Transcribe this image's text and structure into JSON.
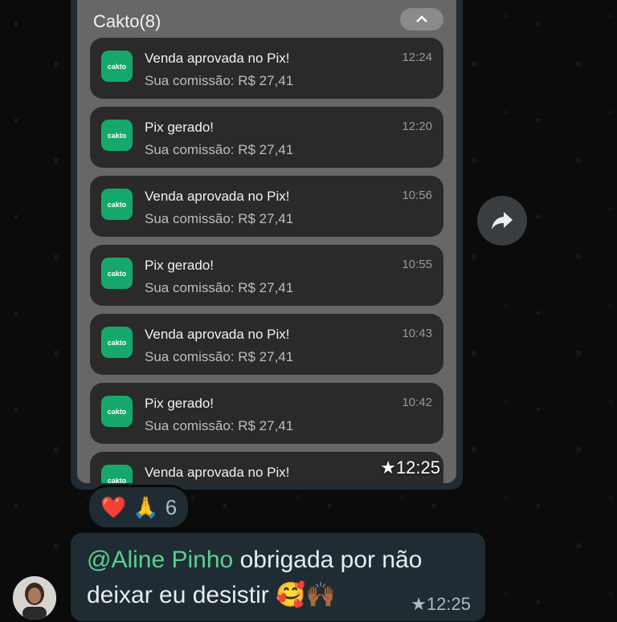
{
  "image_message": {
    "group_title": "Cakto(8)",
    "notifications": [
      {
        "title": "Venda aprovada no Pix!",
        "body": "Sua comissão: R$ 27,41",
        "time": "12:24"
      },
      {
        "title": "Pix gerado!",
        "body": "Sua comissão: R$ 27,41",
        "time": "12:20"
      },
      {
        "title": "Venda aprovada no Pix!",
        "body": "Sua comissão: R$ 27,41",
        "time": "10:56"
      },
      {
        "title": "Pix gerado!",
        "body": "Sua comissão: R$ 27,41",
        "time": "10:55"
      },
      {
        "title": "Venda aprovada no Pix!",
        "body": "Sua comissão: R$ 27,41",
        "time": "10:43"
      },
      {
        "title": "Pix gerado!",
        "body": "Sua comissão: R$ 27,41",
        "time": "10:42"
      },
      {
        "title": "Venda aprovada no Pix!",
        "body": "",
        "time": ""
      }
    ],
    "app_icon_label": "cakto",
    "timestamp": "★12:25"
  },
  "reactions": {
    "emoji_1": "❤️",
    "emoji_2": "🙏",
    "count": "6"
  },
  "text_message": {
    "mention": "@Aline Pinho",
    "text": " obrigada por não deixar eu desistir 🥰🙌🏾",
    "timestamp": "★12:25"
  }
}
